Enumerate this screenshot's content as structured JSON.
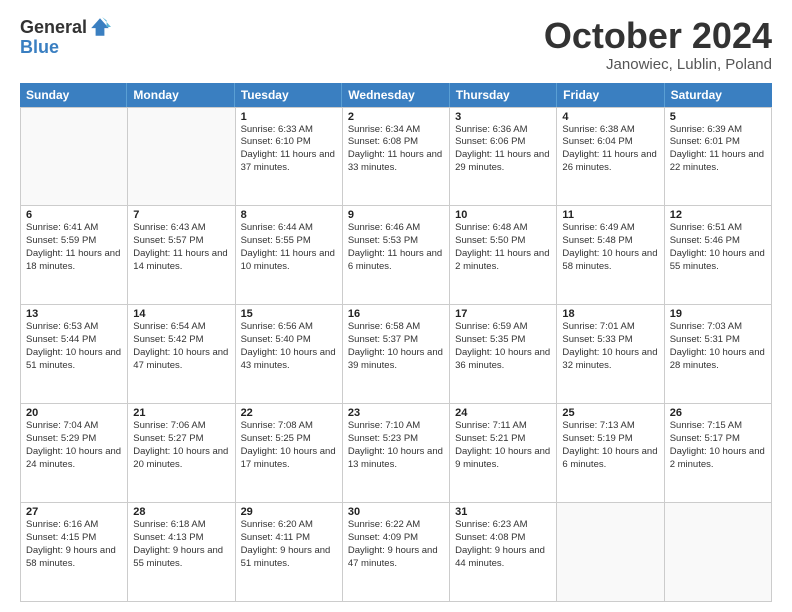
{
  "header": {
    "logo_general": "General",
    "logo_blue": "Blue",
    "title": "October 2024",
    "location": "Janowiec, Lublin, Poland"
  },
  "days_of_week": [
    "Sunday",
    "Monday",
    "Tuesday",
    "Wednesday",
    "Thursday",
    "Friday",
    "Saturday"
  ],
  "weeks": [
    [
      {
        "day": "",
        "sunrise": "",
        "sunset": "",
        "daylight": ""
      },
      {
        "day": "",
        "sunrise": "",
        "sunset": "",
        "daylight": ""
      },
      {
        "day": "1",
        "sunrise": "Sunrise: 6:33 AM",
        "sunset": "Sunset: 6:10 PM",
        "daylight": "Daylight: 11 hours and 37 minutes."
      },
      {
        "day": "2",
        "sunrise": "Sunrise: 6:34 AM",
        "sunset": "Sunset: 6:08 PM",
        "daylight": "Daylight: 11 hours and 33 minutes."
      },
      {
        "day": "3",
        "sunrise": "Sunrise: 6:36 AM",
        "sunset": "Sunset: 6:06 PM",
        "daylight": "Daylight: 11 hours and 29 minutes."
      },
      {
        "day": "4",
        "sunrise": "Sunrise: 6:38 AM",
        "sunset": "Sunset: 6:04 PM",
        "daylight": "Daylight: 11 hours and 26 minutes."
      },
      {
        "day": "5",
        "sunrise": "Sunrise: 6:39 AM",
        "sunset": "Sunset: 6:01 PM",
        "daylight": "Daylight: 11 hours and 22 minutes."
      }
    ],
    [
      {
        "day": "6",
        "sunrise": "Sunrise: 6:41 AM",
        "sunset": "Sunset: 5:59 PM",
        "daylight": "Daylight: 11 hours and 18 minutes."
      },
      {
        "day": "7",
        "sunrise": "Sunrise: 6:43 AM",
        "sunset": "Sunset: 5:57 PM",
        "daylight": "Daylight: 11 hours and 14 minutes."
      },
      {
        "day": "8",
        "sunrise": "Sunrise: 6:44 AM",
        "sunset": "Sunset: 5:55 PM",
        "daylight": "Daylight: 11 hours and 10 minutes."
      },
      {
        "day": "9",
        "sunrise": "Sunrise: 6:46 AM",
        "sunset": "Sunset: 5:53 PM",
        "daylight": "Daylight: 11 hours and 6 minutes."
      },
      {
        "day": "10",
        "sunrise": "Sunrise: 6:48 AM",
        "sunset": "Sunset: 5:50 PM",
        "daylight": "Daylight: 11 hours and 2 minutes."
      },
      {
        "day": "11",
        "sunrise": "Sunrise: 6:49 AM",
        "sunset": "Sunset: 5:48 PM",
        "daylight": "Daylight: 10 hours and 58 minutes."
      },
      {
        "day": "12",
        "sunrise": "Sunrise: 6:51 AM",
        "sunset": "Sunset: 5:46 PM",
        "daylight": "Daylight: 10 hours and 55 minutes."
      }
    ],
    [
      {
        "day": "13",
        "sunrise": "Sunrise: 6:53 AM",
        "sunset": "Sunset: 5:44 PM",
        "daylight": "Daylight: 10 hours and 51 minutes."
      },
      {
        "day": "14",
        "sunrise": "Sunrise: 6:54 AM",
        "sunset": "Sunset: 5:42 PM",
        "daylight": "Daylight: 10 hours and 47 minutes."
      },
      {
        "day": "15",
        "sunrise": "Sunrise: 6:56 AM",
        "sunset": "Sunset: 5:40 PM",
        "daylight": "Daylight: 10 hours and 43 minutes."
      },
      {
        "day": "16",
        "sunrise": "Sunrise: 6:58 AM",
        "sunset": "Sunset: 5:37 PM",
        "daylight": "Daylight: 10 hours and 39 minutes."
      },
      {
        "day": "17",
        "sunrise": "Sunrise: 6:59 AM",
        "sunset": "Sunset: 5:35 PM",
        "daylight": "Daylight: 10 hours and 36 minutes."
      },
      {
        "day": "18",
        "sunrise": "Sunrise: 7:01 AM",
        "sunset": "Sunset: 5:33 PM",
        "daylight": "Daylight: 10 hours and 32 minutes."
      },
      {
        "day": "19",
        "sunrise": "Sunrise: 7:03 AM",
        "sunset": "Sunset: 5:31 PM",
        "daylight": "Daylight: 10 hours and 28 minutes."
      }
    ],
    [
      {
        "day": "20",
        "sunrise": "Sunrise: 7:04 AM",
        "sunset": "Sunset: 5:29 PM",
        "daylight": "Daylight: 10 hours and 24 minutes."
      },
      {
        "day": "21",
        "sunrise": "Sunrise: 7:06 AM",
        "sunset": "Sunset: 5:27 PM",
        "daylight": "Daylight: 10 hours and 20 minutes."
      },
      {
        "day": "22",
        "sunrise": "Sunrise: 7:08 AM",
        "sunset": "Sunset: 5:25 PM",
        "daylight": "Daylight: 10 hours and 17 minutes."
      },
      {
        "day": "23",
        "sunrise": "Sunrise: 7:10 AM",
        "sunset": "Sunset: 5:23 PM",
        "daylight": "Daylight: 10 hours and 13 minutes."
      },
      {
        "day": "24",
        "sunrise": "Sunrise: 7:11 AM",
        "sunset": "Sunset: 5:21 PM",
        "daylight": "Daylight: 10 hours and 9 minutes."
      },
      {
        "day": "25",
        "sunrise": "Sunrise: 7:13 AM",
        "sunset": "Sunset: 5:19 PM",
        "daylight": "Daylight: 10 hours and 6 minutes."
      },
      {
        "day": "26",
        "sunrise": "Sunrise: 7:15 AM",
        "sunset": "Sunset: 5:17 PM",
        "daylight": "Daylight: 10 hours and 2 minutes."
      }
    ],
    [
      {
        "day": "27",
        "sunrise": "Sunrise: 6:16 AM",
        "sunset": "Sunset: 4:15 PM",
        "daylight": "Daylight: 9 hours and 58 minutes."
      },
      {
        "day": "28",
        "sunrise": "Sunrise: 6:18 AM",
        "sunset": "Sunset: 4:13 PM",
        "daylight": "Daylight: 9 hours and 55 minutes."
      },
      {
        "day": "29",
        "sunrise": "Sunrise: 6:20 AM",
        "sunset": "Sunset: 4:11 PM",
        "daylight": "Daylight: 9 hours and 51 minutes."
      },
      {
        "day": "30",
        "sunrise": "Sunrise: 6:22 AM",
        "sunset": "Sunset: 4:09 PM",
        "daylight": "Daylight: 9 hours and 47 minutes."
      },
      {
        "day": "31",
        "sunrise": "Sunrise: 6:23 AM",
        "sunset": "Sunset: 4:08 PM",
        "daylight": "Daylight: 9 hours and 44 minutes."
      },
      {
        "day": "",
        "sunrise": "",
        "sunset": "",
        "daylight": ""
      },
      {
        "day": "",
        "sunrise": "",
        "sunset": "",
        "daylight": ""
      }
    ]
  ]
}
